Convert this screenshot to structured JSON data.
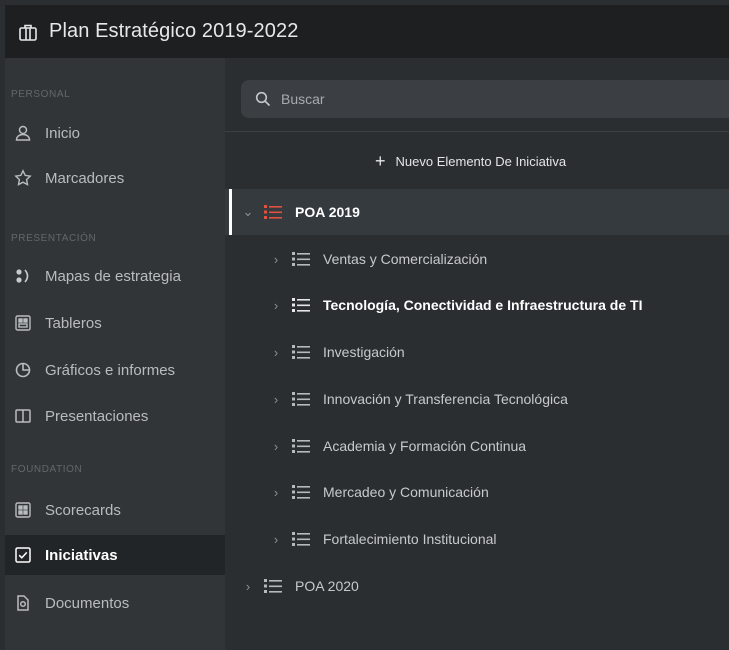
{
  "header": {
    "title": "Plan Estratégico 2019-2022",
    "icon": "briefcase-icon"
  },
  "sidebar": {
    "sections": [
      {
        "label": "PERSONAL"
      },
      {
        "label": "PRESENTACIÓN"
      },
      {
        "label": "FOUNDATION"
      }
    ],
    "items": [
      {
        "label": "Inicio",
        "icon": "user-icon"
      },
      {
        "label": "Marcadores",
        "icon": "star-icon"
      },
      {
        "label": "Mapas de estrategia",
        "icon": "strategy-map-icon"
      },
      {
        "label": "Tableros",
        "icon": "dashboard-icon"
      },
      {
        "label": "Gráficos e informes",
        "icon": "pie-chart-icon"
      },
      {
        "label": "Presentaciones",
        "icon": "book-icon"
      },
      {
        "label": "Scorecards",
        "icon": "scorecard-icon"
      },
      {
        "label": "Iniciativas",
        "icon": "checkbox-icon",
        "active": true
      },
      {
        "label": "Documentos",
        "icon": "document-icon"
      }
    ]
  },
  "main": {
    "search": {
      "placeholder": "Buscar"
    },
    "new_button": {
      "label": "Nuevo Elemento De Iniciativa"
    },
    "tree": [
      {
        "label": "POA 2019",
        "level": 0,
        "expanded": true,
        "selected": true,
        "icon_color": "#e0523f"
      },
      {
        "label": "Ventas y Comercialización",
        "level": 1
      },
      {
        "label": "Tecnología, Conectividad e Infraestructura de TI",
        "level": 1,
        "bold": true
      },
      {
        "label": "Investigación",
        "level": 1
      },
      {
        "label": "Innovación y Transferencia Tecnológica",
        "level": 1
      },
      {
        "label": "Academia y Formación Continua",
        "level": 1
      },
      {
        "label": "Mercadeo y Comunicación",
        "level": 1
      },
      {
        "label": "Fortalecimiento Institucional",
        "level": 1
      },
      {
        "label": "POA 2020",
        "level": 0
      }
    ]
  },
  "colors": {
    "header_bg": "#1d1f21",
    "sidebar_bg": "#323538",
    "main_bg": "#2b2e31",
    "accent_red": "#e0523f"
  }
}
